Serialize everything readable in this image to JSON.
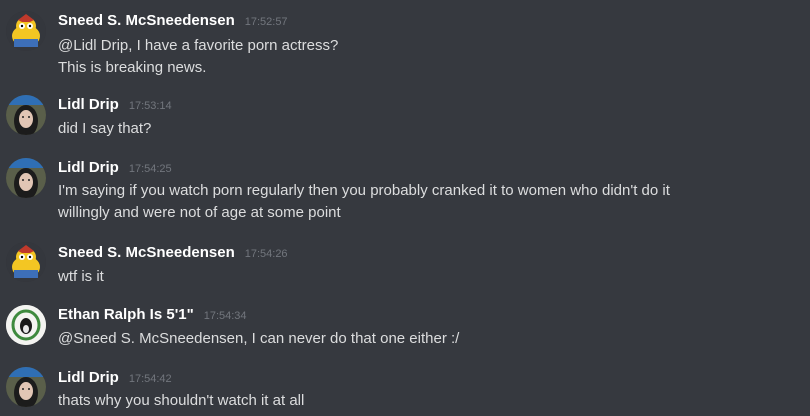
{
  "messages": [
    {
      "avatar": "sneed-cartoon-avatar",
      "username": "Sneed S. McSneedensen",
      "time": "17:52:57",
      "lines": [
        "@Lidl Drip, I have a favorite porn actress?",
        "This is breaking news."
      ]
    },
    {
      "avatar": "lidl-drip-avatar",
      "username": "Lidl Drip",
      "time": "17:53:14",
      "lines": [
        "did I say that?"
      ]
    },
    {
      "avatar": "lidl-drip-avatar",
      "username": "Lidl Drip",
      "time": "17:54:25",
      "lines": [
        "I'm saying if you watch porn regularly then you probably cranked it to women who didn't do it",
        "willingly and were not of age at some point"
      ]
    },
    {
      "avatar": "sneed-cartoon-avatar",
      "username": "Sneed S. McSneedensen",
      "time": "17:54:26",
      "lines": [
        "wtf is it"
      ]
    },
    {
      "avatar": "ethan-ralph-avatar",
      "username": "Ethan Ralph Is 5'1\"",
      "time": "17:54:34",
      "lines": [
        "@Sneed S. McSneedensen, I can never do that one either :/"
      ]
    },
    {
      "avatar": "lidl-drip-avatar",
      "username": "Lidl Drip",
      "time": "17:54:42",
      "lines": [
        "thats why you shouldn't watch it at all"
      ]
    }
  ]
}
